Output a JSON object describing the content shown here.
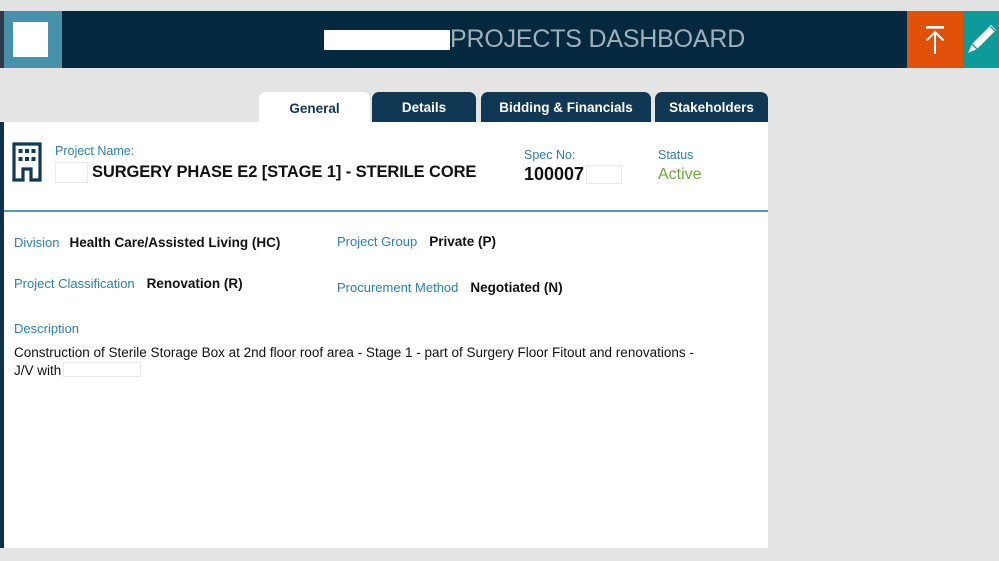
{
  "header": {
    "title": "PROJECTS DASHBOARD",
    "logo_alt": "company-logo",
    "actions": [
      {
        "name": "upload-button",
        "icon": "upload-arrow-icon",
        "color": "#e2510a"
      },
      {
        "name": "edit-button",
        "icon": "pencil-icon",
        "color": "#0d9a98"
      }
    ],
    "colors": {
      "bar": "#04293f",
      "logo_block": "#4891ab",
      "title_text": "#9fb0ba"
    }
  },
  "tabs": [
    {
      "label": "General",
      "active": true
    },
    {
      "label": "Details",
      "active": false
    },
    {
      "label": "Bidding & Financials",
      "active": false
    },
    {
      "label": "Stakeholders",
      "active": false
    }
  ],
  "project": {
    "name_label": "Project Name:",
    "name_value": "SURGERY PHASE E2 [STAGE 1] - STERILE CORE",
    "spec_label": "Spec No:",
    "spec_value": "100007",
    "status_label": "Status",
    "status_value": "Active",
    "status_color": "#6fa83f"
  },
  "fields": [
    {
      "label": "Division",
      "value": "Health Care/Assisted Living (HC)"
    },
    {
      "label": "Project Group",
      "value": "Private (P)"
    },
    {
      "label": "Project Classification",
      "value": "Renovation (R)"
    },
    {
      "label": "Procurement Method",
      "value": "Negotiated (N)"
    }
  ],
  "description": {
    "label": "Description",
    "text_before": "Construction of Sterile Storage Box at 2nd floor roof area - Stage 1 - part of Surgery Floor Fitout and renovations - J/V with"
  }
}
